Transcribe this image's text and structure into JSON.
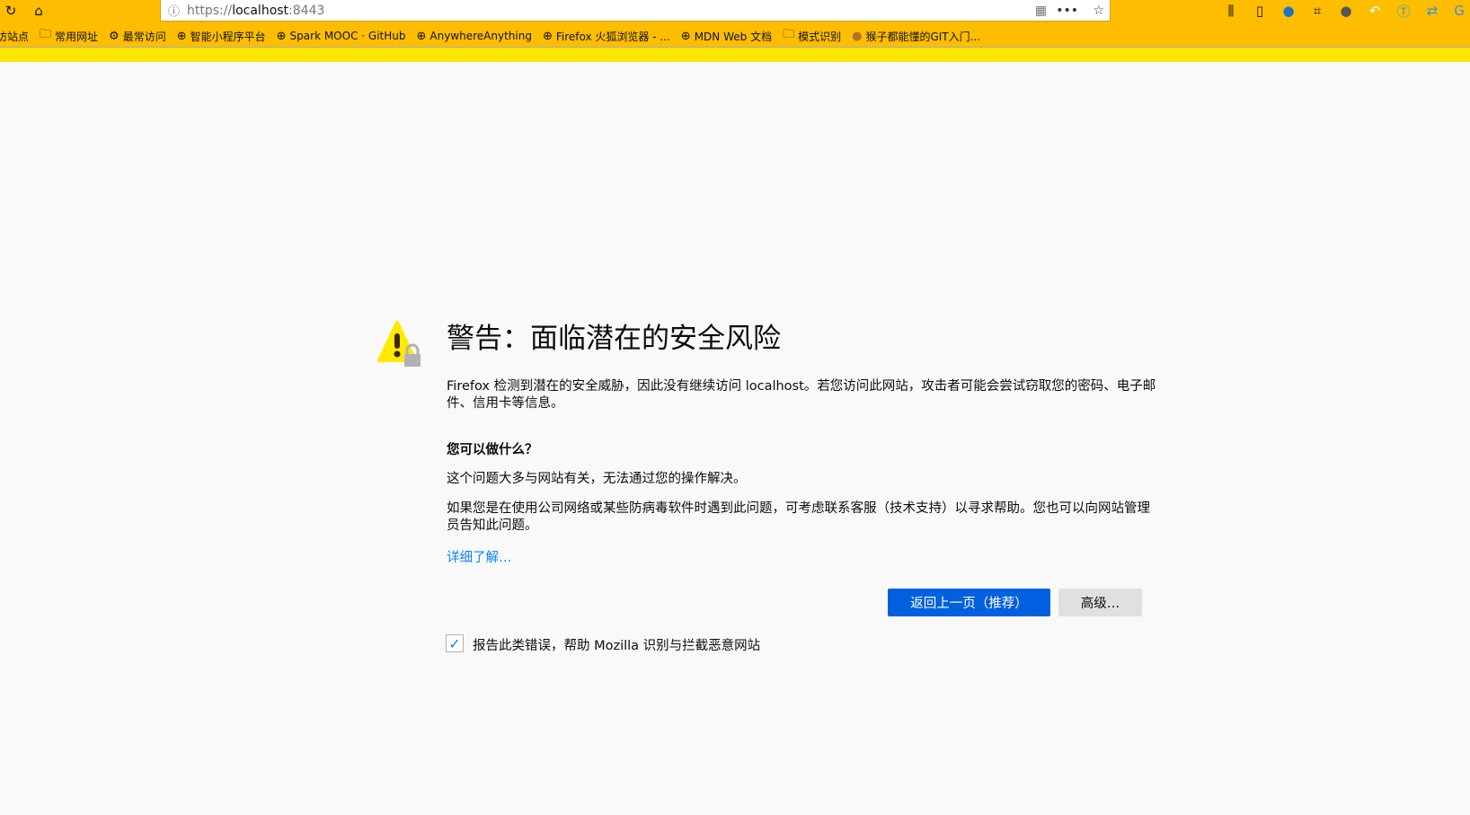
{
  "browser": {
    "url_prefix": "https://",
    "url_host": "localhost",
    "url_port": ":8443",
    "bookmarks": [
      {
        "label": "访站点",
        "icon": "folder-icon"
      },
      {
        "label": "常用网址",
        "icon": "folder-icon"
      },
      {
        "label": "最常访问",
        "icon": "gear-icon"
      },
      {
        "label": "智能小程序平台",
        "icon": "globe-icon"
      },
      {
        "label": "Spark MOOC · GitHub",
        "icon": "globe-icon"
      },
      {
        "label": "AnywhereAnything",
        "icon": "globe-icon"
      },
      {
        "label": "Firefox 火狐浏览器 - ...",
        "icon": "globe-icon"
      },
      {
        "label": "MDN Web 文档",
        "icon": "globe-icon"
      },
      {
        "label": "模式识别",
        "icon": "folder-icon"
      },
      {
        "label": "猴子都能懂的GIT入门...",
        "icon": "monkey-icon"
      }
    ]
  },
  "page": {
    "title": "警告：面临潜在的安全风险",
    "intro": "Firefox 检测到潜在的安全威胁，因此没有继续访问 localhost。若您访问此网站，攻击者可能会尝试窃取您的密码、电子邮件、信用卡等信息。",
    "what_heading": "您可以做什么？",
    "para1": "这个问题大多与网站有关，无法通过您的操作解决。",
    "para2": "如果您是在使用公司网络或某些防病毒软件时遇到此问题，可考虑联系客服（技术支持）以寻求帮助。您也可以向网站管理员告知此问题。",
    "learn_more": "详细了解…",
    "back_button": "返回上一页（推荐）",
    "advanced_button": "高级…",
    "report_label": "报告此类错误，帮助 Mozilla 识别与拦截恶意网站",
    "report_checked": true
  }
}
